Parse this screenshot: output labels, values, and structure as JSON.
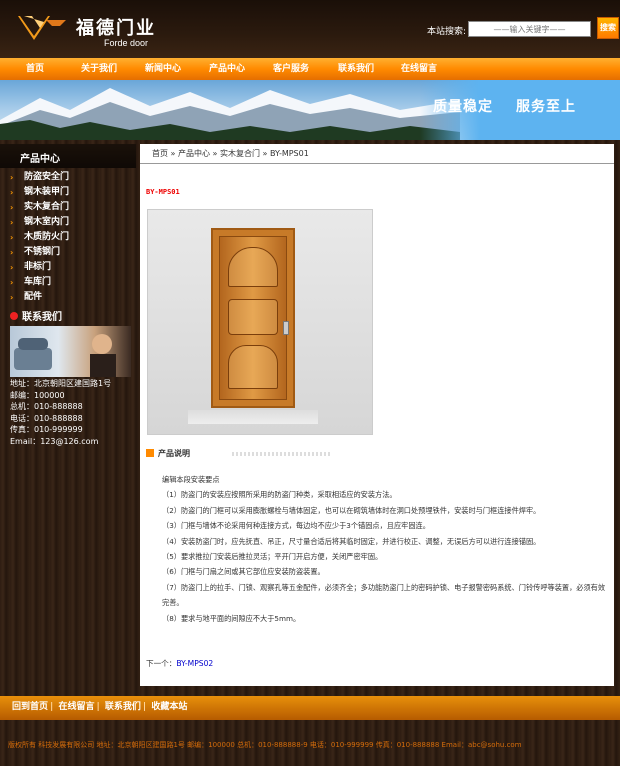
{
  "brand": {
    "name_cn": "福德门业",
    "name_en": "Forde door"
  },
  "search": {
    "label": "本站搜索:",
    "placeholder": "——输入关键字——",
    "button": "搜索"
  },
  "nav": [
    "首页",
    "关于我们",
    "新闻中心",
    "产品中心",
    "客户服务",
    "联系我们",
    "在线留言"
  ],
  "banner": {
    "slogan1": "质量稳定",
    "slogan2": "服务至上"
  },
  "sidebar": {
    "title": "产品中心",
    "items": [
      "防盗安全门",
      "钢木装甲门",
      "实木复合门",
      "钢木室内门",
      "木质防火门",
      "不锈钢门",
      "非标门",
      "车库门",
      "配件"
    ],
    "contact_title": "联系我们",
    "contact": [
      "地址：北京朝阳区建国路1号",
      "邮编：100000",
      "总机：010-888888",
      "电话：010-888888",
      "传真：010-999999",
      "Email：123@126.com"
    ]
  },
  "main": {
    "breadcrumb": [
      "首页",
      "产品中心",
      "实木复合门",
      "BY-MPS01"
    ],
    "product_title": "BY-MPS01",
    "section_title": "产品说明",
    "description": [
      "编辑本段安装要点",
      "（1）防盗门的安装应按照所采用的防盗门种类，采取相适应的安装方法。",
      "（2）防盗门的门框可以采用膨胀螺栓与墙体固定，也可以在砌筑墙体时在洞口处预埋铁件，安装时与门框连接件焊牢。",
      "（3）门框与墙体不论采用何种连接方式，每边均不应少于3个锚固点，且应牢固连。",
      "（4）安装防盗门时，应先抚直、吊正，尺寸量合适后将其临时固定，并进行校正、调整，无误后方可以进行连接锚固。",
      "（5）要求推拉门安装后推拉灵活；平开门开启方便，关闭严密牢固。",
      "（6）门框与门扇之间或其它部位应安装防盗装置。",
      "（7）防盗门上的拉手、门锁、观察孔等五金配件，必须齐全；多功能防盗门上的密码护锁、电子报警密码系统、门铃传呼等装置，必须有效完善。",
      "（8）要求与地平面的间隙应不大于5mm。"
    ],
    "next_label": "下一个：",
    "next_link": "BY-MPS02"
  },
  "footer": {
    "links": [
      "回到首页",
      "在线留言",
      "联系我们",
      "收藏本站"
    ],
    "copyright": "版权所有  科技发展有限公司  地址：北京朝阳区建国路1号  邮编：100000  总机：010-888888-9  电话：010-999999  传真：010-888888  Email：abc@sohu.com"
  },
  "colors": {
    "accent": "#ff8a00",
    "title_red": "#e00000",
    "link": "#0000cc"
  }
}
